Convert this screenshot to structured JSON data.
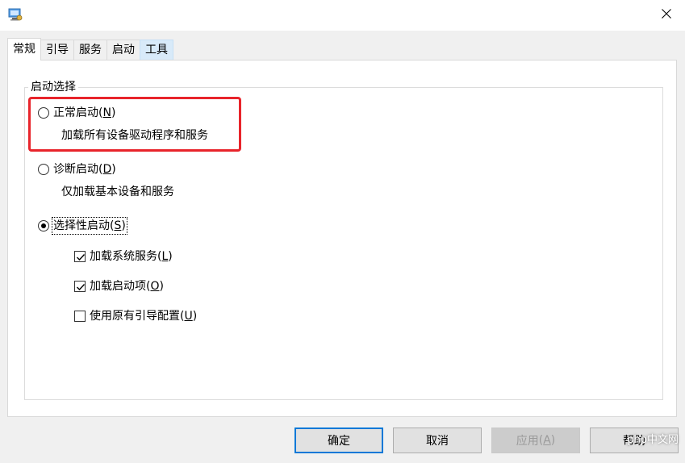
{
  "titlebar": {
    "icon": "system-config-icon",
    "close_glyph": "✕"
  },
  "tabs": [
    {
      "label": "常规",
      "active": true
    },
    {
      "label": "引导"
    },
    {
      "label": "服务"
    },
    {
      "label": "启动"
    },
    {
      "label": "工具",
      "hover": true
    }
  ],
  "group": {
    "legend": "启动选择",
    "options": [
      {
        "label": "正常启动",
        "key": "N",
        "checked": false,
        "desc": "加载所有设备驱动程序和服务"
      },
      {
        "label": "诊断启动",
        "key": "D",
        "checked": false,
        "desc": "仅加载基本设备和服务"
      },
      {
        "label": "选择性启动",
        "key": "S",
        "checked": true
      }
    ],
    "checkboxes": [
      {
        "label": "加载系统服务",
        "key": "L",
        "checked": true
      },
      {
        "label": "加载启动项",
        "key": "O",
        "checked": true
      },
      {
        "label": "使用原有引导配置",
        "key": "U",
        "checked": false
      }
    ]
  },
  "buttons": {
    "ok": "确定",
    "cancel": "取消",
    "apply": "应用",
    "apply_key": "A",
    "help": "帮助"
  },
  "watermark": "php中文网",
  "colors": {
    "highlight": "#e8242b",
    "default_button_border": "#0078d7",
    "tab_hover": "#d8eaf9"
  }
}
